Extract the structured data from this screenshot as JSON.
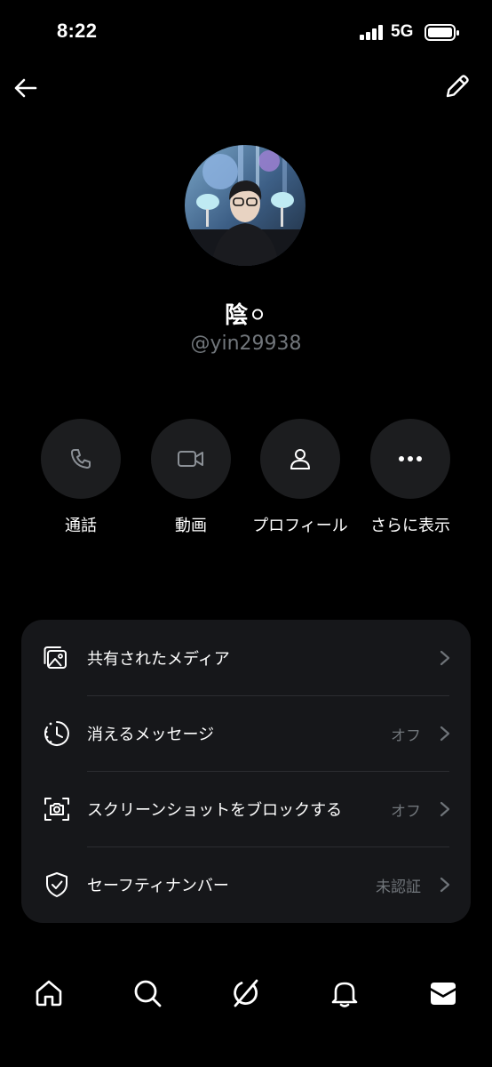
{
  "status_bar": {
    "time": "8:22",
    "network": "5G",
    "signal_icon": "signal-bars-icon",
    "battery_icon": "battery-icon"
  },
  "header": {
    "back_icon": "back-arrow-icon",
    "edit_icon": "pencil-icon"
  },
  "profile": {
    "display_name": "陰⚪",
    "handle": "@yin29938"
  },
  "actions": [
    {
      "label": "通話",
      "icon": "phone-icon"
    },
    {
      "label": "動画",
      "icon": "video-camera-icon"
    },
    {
      "label": "プロフィール",
      "icon": "person-icon"
    },
    {
      "label": "さらに表示",
      "icon": "more-dots-icon"
    }
  ],
  "settings": [
    {
      "label": "共有されたメディア",
      "value": "",
      "icon": "media-icon"
    },
    {
      "label": "消えるメッセージ",
      "value": "オフ",
      "icon": "timer-icon"
    },
    {
      "label": "スクリーンショットをブロックする",
      "value": "オフ",
      "icon": "screenshot-camera-icon"
    },
    {
      "label": "セーフティナンバー",
      "value": "未認証",
      "icon": "shield-check-icon"
    }
  ],
  "tab_bar": {
    "items": [
      "home-icon",
      "search-icon",
      "grok-icon",
      "notifications-bell-icon",
      "messages-envelope-icon"
    ],
    "active": "messages-envelope-icon"
  },
  "colors": {
    "background": "#000000",
    "card": "#16171a",
    "action_circle": "#1c1d1f",
    "secondary_text": "#71767b",
    "primary_text": "#ffffff"
  }
}
